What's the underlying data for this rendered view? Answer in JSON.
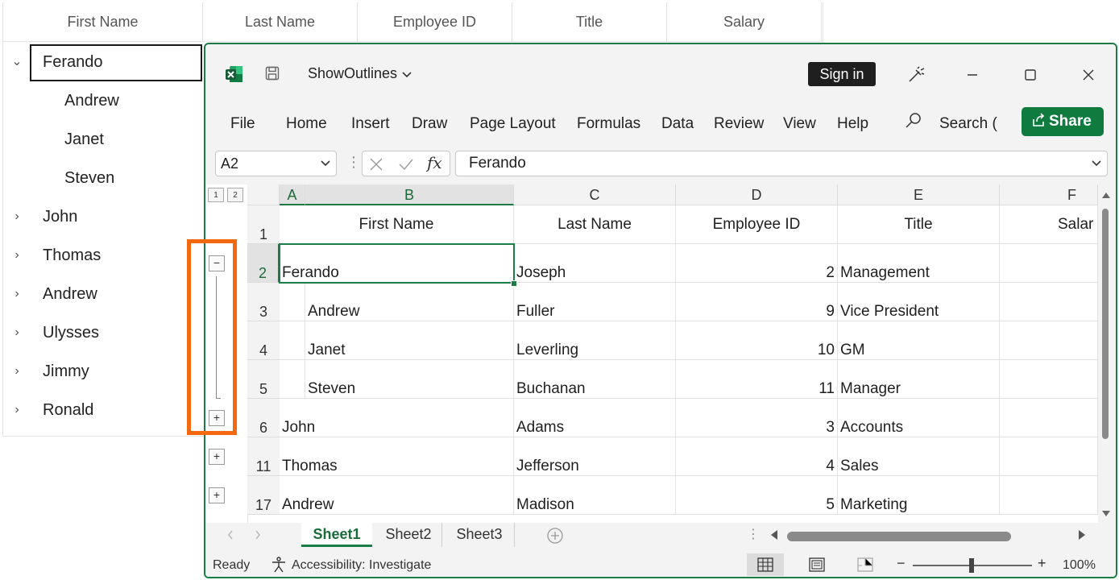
{
  "tree_grid": {
    "columns": [
      "First Name",
      "Last Name",
      "Employee ID",
      "Title",
      "Salary"
    ],
    "rows": [
      {
        "label": "Ferando",
        "expanded": true,
        "selected": true,
        "level": 0
      },
      {
        "label": "Andrew",
        "level": 1
      },
      {
        "label": "Janet",
        "level": 1
      },
      {
        "label": "Steven",
        "level": 1
      },
      {
        "label": "John",
        "level": 0
      },
      {
        "label": "Thomas",
        "level": 0
      },
      {
        "label": "Andrew",
        "level": 0
      },
      {
        "label": "Ulysses",
        "level": 0
      },
      {
        "label": "Jimmy",
        "level": 0
      },
      {
        "label": "Ronald",
        "level": 0
      }
    ]
  },
  "excel": {
    "doc_title": "ShowOutlines",
    "sign_in": "Sign in",
    "menu": [
      "File",
      "Home",
      "Insert",
      "Draw",
      "Page Layout",
      "Formulas",
      "Data",
      "Review",
      "View",
      "Help"
    ],
    "search_label": "Search (",
    "share_label": "Share",
    "name_box": "A2",
    "fx_label": "fx",
    "formula_value": "Ferando",
    "outline_levels": [
      "1",
      "2"
    ],
    "outline_buttons": [
      "−",
      "+",
      "+",
      "+"
    ],
    "columns": [
      "A",
      "B",
      "C",
      "D",
      "E",
      "F"
    ],
    "row_numbers": [
      "1",
      "2",
      "3",
      "4",
      "5",
      "6",
      "11",
      "17"
    ],
    "header_row": [
      "First Name",
      "Last Name",
      "Employee ID",
      "Title",
      "Salar"
    ],
    "rows": [
      {
        "first": "Ferando",
        "last": "Joseph",
        "id": "2",
        "title": "Management"
      },
      {
        "first": "Andrew",
        "last": "Fuller",
        "id": "9",
        "title": "Vice President"
      },
      {
        "first": "Janet",
        "last": "Leverling",
        "id": "10",
        "title": "GM"
      },
      {
        "first": "Steven",
        "last": "Buchanan",
        "id": "11",
        "title": "Manager"
      },
      {
        "first": "John",
        "last": "Adams",
        "id": "3",
        "title": "Accounts"
      },
      {
        "first": "Thomas",
        "last": "Jefferson",
        "id": "4",
        "title": "Sales"
      },
      {
        "first": "Andrew",
        "last": "Madison",
        "id": "5",
        "title": "Marketing"
      }
    ],
    "sheets": [
      "Sheet1",
      "Sheet2",
      "Sheet3"
    ],
    "status": {
      "ready": "Ready",
      "accessibility": "Accessibility: Investigate",
      "zoom_minus": "−",
      "zoom_plus": "+",
      "zoom": "100%"
    },
    "accent_color": "#1b7c45",
    "highlight_color": "#f4680f"
  }
}
